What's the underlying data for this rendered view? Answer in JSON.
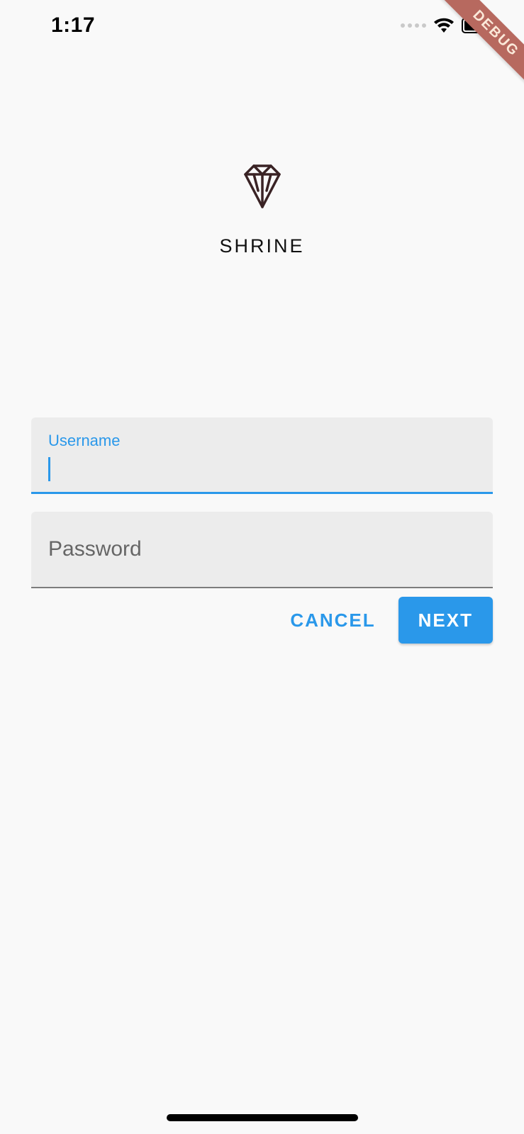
{
  "status": {
    "time": "1:17"
  },
  "debug_banner": "DEBUG",
  "app": {
    "name": "SHRINE"
  },
  "form": {
    "username": {
      "label": "Username",
      "value": ""
    },
    "password": {
      "label": "Password",
      "value": ""
    }
  },
  "buttons": {
    "cancel": "CANCEL",
    "next": "NEXT"
  },
  "colors": {
    "primary": "#2a98ea",
    "debug_banner": "#b7695f",
    "field_bg": "#ececec"
  }
}
